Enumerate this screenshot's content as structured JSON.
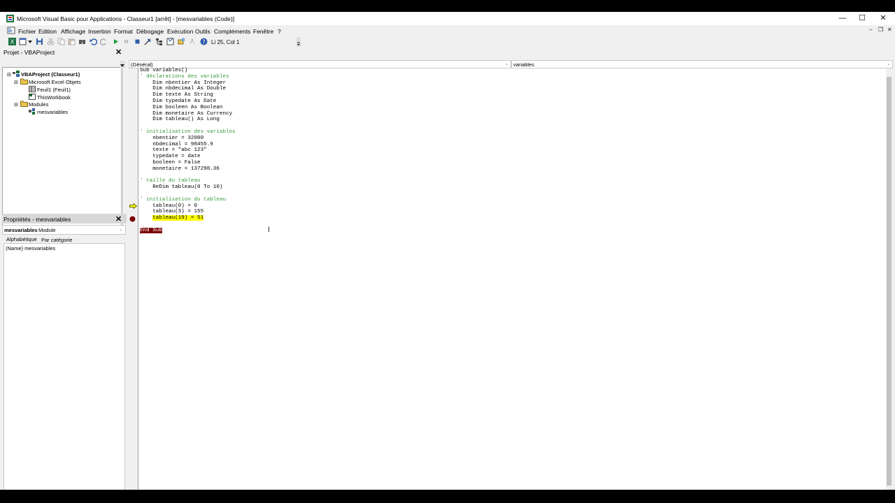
{
  "window": {
    "title": "Microsoft Visual Basic pour Applications - Classeur1 [arrêt] - [mesvariables (Code)]",
    "minimize": "—",
    "maximize": "☐",
    "close": "✕"
  },
  "menu": {
    "items": [
      "Fichier",
      "Edition",
      "Affichage",
      "Insertion",
      "Format",
      "Débogage",
      "Exécution",
      "Outils",
      "Compléments",
      "Fenêtre",
      "?"
    ]
  },
  "toolbar": {
    "status": "Li 25, Col 1"
  },
  "project_panel": {
    "title": "Projet - VBAProject",
    "tree": {
      "root": "VBAProject (Classeur1)",
      "excel_objects": "Microsoft Excel Objets",
      "sheet1": "Feuil1 (Feuil1)",
      "workbook": "ThisWorkbook",
      "modules": "Modules",
      "module1": "mesvariables"
    }
  },
  "properties_panel": {
    "title": "Propriétés - mesvariables",
    "object_name": "mesvariables",
    "object_type": "Module",
    "tab_alpha": "Alphabétique",
    "tab_category": "Par catégorie",
    "row": "(Name) mesvariables"
  },
  "code_window": {
    "object_combo": "(Général)",
    "proc_combo": "variables",
    "lines": [
      {
        "text": "Sub variables()",
        "type": "code"
      },
      {
        "text": "' déclarations des variables",
        "type": "comment"
      },
      {
        "text": "    Dim nbentier As Integer",
        "type": "code"
      },
      {
        "text": "    Dim nbdecimal As Double",
        "type": "code"
      },
      {
        "text": "    Dim texte As String",
        "type": "code"
      },
      {
        "text": "    Dim typedate As Date",
        "type": "code"
      },
      {
        "text": "    Dim booleen As Boolean",
        "type": "code"
      },
      {
        "text": "    Dim monetaire As Currency",
        "type": "code"
      },
      {
        "text": "    Dim tableau() As Long",
        "type": "code"
      },
      {
        "text": "",
        "type": "code"
      },
      {
        "text": "' initialisation des variables",
        "type": "comment"
      },
      {
        "text": "    nbentier = 32000",
        "type": "code"
      },
      {
        "text": "    nbdecimal = 98455.9",
        "type": "code"
      },
      {
        "text": "    texte = \"abc 123\"",
        "type": "code"
      },
      {
        "text": "    typedate = date",
        "type": "code"
      },
      {
        "text": "    booleen = False",
        "type": "code"
      },
      {
        "text": "    monetaire = 137298.36",
        "type": "code"
      },
      {
        "text": "",
        "type": "code"
      },
      {
        "text": "' taille du tableau",
        "type": "comment"
      },
      {
        "text": "    ReDim tableau(0 To 10)",
        "type": "code"
      },
      {
        "text": "",
        "type": "code"
      },
      {
        "text": "' initialisation du tableau",
        "type": "comment"
      },
      {
        "text": "    tableau(0) = 0",
        "type": "code"
      },
      {
        "text": "    tableau(3) = 155",
        "type": "code"
      },
      {
        "text": "    tableau(19) = 51",
        "type": "current",
        "indent": "    ",
        "body": "tableau(19) = 51"
      },
      {
        "text": "",
        "type": "code"
      },
      {
        "text": "End Sub",
        "type": "breakpoint"
      }
    ]
  },
  "colors": {
    "comment": "#3d9a3d",
    "current_line": "#ffff00",
    "breakpoint": "#7a0000"
  },
  "icons": {
    "app": "vba-app-icon",
    "next_statement": "yellow-arrow-icon",
    "breakpoint": "breakpoint-dot-icon"
  }
}
